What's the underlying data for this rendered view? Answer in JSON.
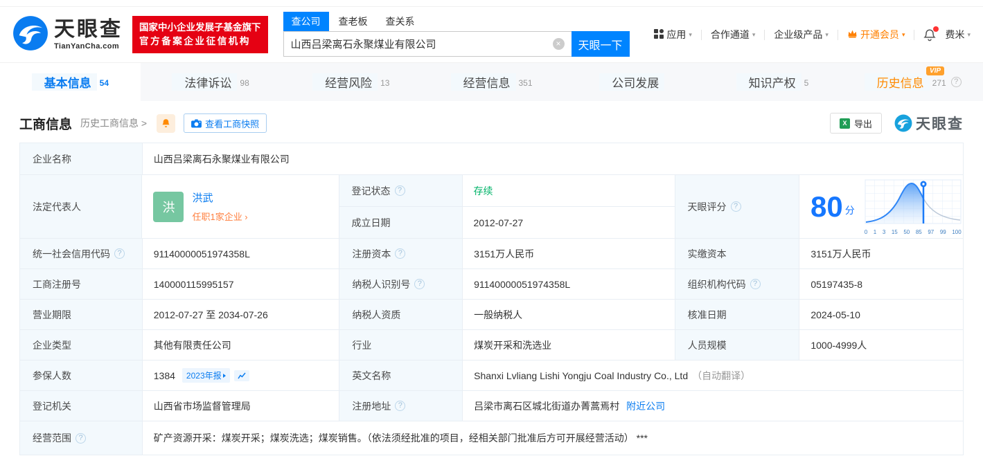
{
  "brand": {
    "name": "天眼查",
    "domain": "TianYanCha.com",
    "badge_line1": "国家中小企业发展子基金旗下",
    "badge_line2": "官方备案企业征信机构"
  },
  "colors": {
    "accent_blue": "#0084ff",
    "vip_orange": "#ff8a00",
    "status_green": "#00b368",
    "badge_red": "#e50113"
  },
  "icons": {
    "help": "?",
    "caret": "▾",
    "clear": "×",
    "excel": "X",
    "vip": "VIP"
  },
  "search": {
    "tabs": [
      {
        "label": "查公司"
      },
      {
        "label": "查老板"
      },
      {
        "label": "查关系"
      }
    ],
    "value": "山西吕梁离石永聚煤业有限公司",
    "button": "天眼一下"
  },
  "top_nav": {
    "apps": "应用",
    "partner": "合作通道",
    "enterprise": "企业级产品",
    "vip": "开通会员",
    "user": "费米"
  },
  "tabs": [
    {
      "label": "基本信息",
      "count": "54"
    },
    {
      "label": "法律诉讼",
      "count": "98"
    },
    {
      "label": "经营风险",
      "count": "13"
    },
    {
      "label": "经营信息",
      "count": "351"
    },
    {
      "label": "公司发展",
      "count": ""
    },
    {
      "label": "知识产权",
      "count": "5"
    },
    {
      "label": "历史信息",
      "count": "271"
    }
  ],
  "section": {
    "title": "工商信息",
    "history": "历史工商信息 >",
    "snapshot": "查看工商快照",
    "export": "导出"
  },
  "score": {
    "label": "天眼评分",
    "value": "80",
    "unit": "分",
    "axis": [
      "0",
      "1",
      "3",
      "15",
      "50",
      "85",
      "97",
      "99",
      "100"
    ]
  },
  "fields": {
    "company_name": {
      "label": "企业名称",
      "value": "山西吕梁离石永聚煤业有限公司"
    },
    "legal_rep": {
      "label": "法定代表人",
      "avatar": "洪",
      "name": "洪武",
      "sub": "任职1家企业 ›"
    },
    "reg_status": {
      "label": "登记状态",
      "value": "存续"
    },
    "est_date": {
      "label": "成立日期",
      "value": "2012-07-27"
    },
    "credit_code": {
      "label": "统一社会信用代码",
      "value": "91140000051974358L"
    },
    "reg_capital": {
      "label": "注册资本",
      "value": "3151万人民币"
    },
    "paid_capital": {
      "label": "实缴资本",
      "value": "3151万人民币"
    },
    "reg_number": {
      "label": "工商注册号",
      "value": "140000115995157"
    },
    "taxpayer_id": {
      "label": "纳税人识别号",
      "value": "91140000051974358L"
    },
    "org_code": {
      "label": "组织机构代码",
      "value": "05197435-8"
    },
    "business_term": {
      "label": "营业期限",
      "value": "2012-07-27 至 2034-07-26"
    },
    "taxpayer_quality": {
      "label": "纳税人资质",
      "value": "一般纳税人"
    },
    "approval_date": {
      "label": "核准日期",
      "value": "2024-05-10"
    },
    "company_type": {
      "label": "企业类型",
      "value": "其他有限责任公司"
    },
    "industry": {
      "label": "行业",
      "value": "煤炭开采和洗选业"
    },
    "staff_size": {
      "label": "人员规模",
      "value": "1000-4999人"
    },
    "insured_count": {
      "label": "参保人数",
      "value": "1384",
      "report_badge": "2023年报"
    },
    "english_name": {
      "label": "英文名称",
      "value": "Shanxi Lvliang Lishi Yongju Coal Industry Co., Ltd",
      "note": "（自动翻译）"
    },
    "reg_authority": {
      "label": "登记机关",
      "value": "山西省市场监督管理局"
    },
    "reg_address": {
      "label": "注册地址",
      "value": "吕梁市离石区城北街道办菁蒿焉村",
      "nearby": "附近公司"
    },
    "business_scope": {
      "label": "经营范围",
      "value": "矿产资源开采：煤炭开采；煤炭洗选；煤炭销售。（依法须经批准的项目，经相关部门批准后方可开展经营活动） ***"
    }
  }
}
